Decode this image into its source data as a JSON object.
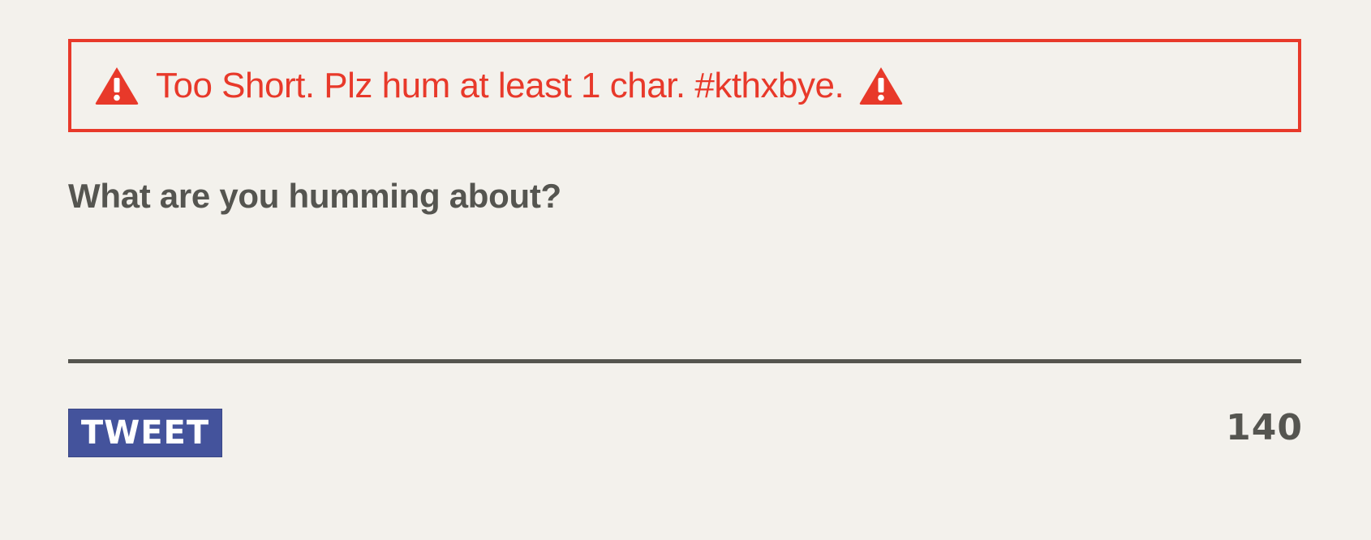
{
  "alert": {
    "message": "Too Short. Plz hum at least 1 char. #kthxbye.",
    "icon": "warning-triangle-icon",
    "color": "#e8392a"
  },
  "compose": {
    "label": "What are you humming about?",
    "value": "",
    "placeholder": ""
  },
  "actions": {
    "tweet_label": "TWEET",
    "tweet_color": "#44539c"
  },
  "counter": {
    "remaining": "140"
  },
  "colors": {
    "background": "#f3f1ec",
    "text": "#555550"
  }
}
